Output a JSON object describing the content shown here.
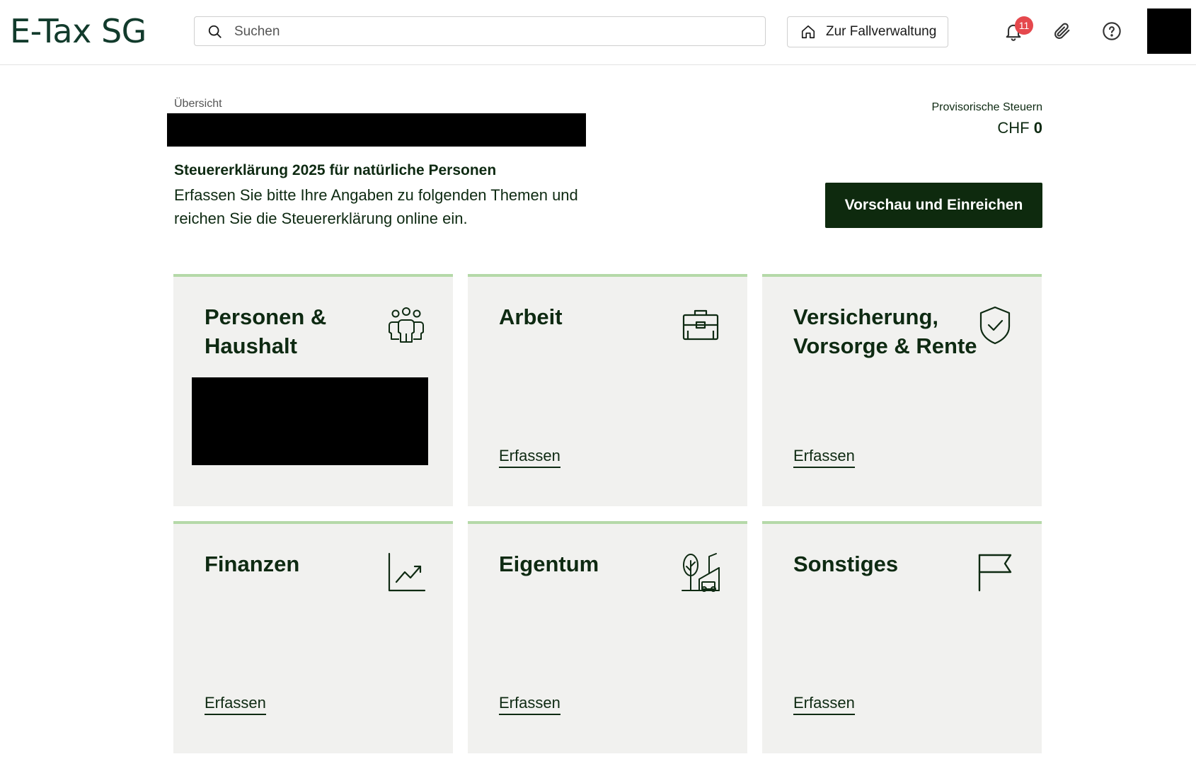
{
  "header": {
    "logo": "E-Tax SG",
    "search": {
      "placeholder": "Suchen",
      "value": ""
    },
    "case_button_label": "Zur Fallverwaltung",
    "notifications_count": "11",
    "icons": {
      "search": "search-icon",
      "home": "home-icon",
      "bell": "bell-icon",
      "attachment": "paperclip-icon",
      "help": "help-icon"
    }
  },
  "intro": {
    "breadcrumb": "Übersicht",
    "heading": "Steuererklärung 2025 für natürliche Personen",
    "text": "Erfassen Sie bitte Ihre Angaben zu folgenden Themen und reichen Sie die Steuererklärung online ein."
  },
  "taxes": {
    "label": "Provisorische Steuern",
    "currency": "CHF",
    "amount": "0"
  },
  "submit_button_label": "Vorschau und Einreichen",
  "cards": [
    {
      "title": "Personen & Haushalt",
      "icon": "people-icon",
      "link": ""
    },
    {
      "title": "Arbeit",
      "icon": "briefcase-icon",
      "link": "Erfassen"
    },
    {
      "title": "Versicherung, Vorsorge & Rente",
      "icon": "shield-check-icon",
      "link": "Erfassen"
    },
    {
      "title": "Finanzen",
      "icon": "chart-up-icon",
      "link": "Erfassen"
    },
    {
      "title": "Eigentum",
      "icon": "property-icon",
      "link": "Erfassen"
    },
    {
      "title": "Sonstiges",
      "icon": "flag-icon",
      "link": "Erfassen"
    }
  ],
  "colors": {
    "brand_dark": "#0e2a0e",
    "card_bg": "#f1f1ef",
    "card_accent": "#b5d9a8",
    "badge": "#e5484d"
  }
}
